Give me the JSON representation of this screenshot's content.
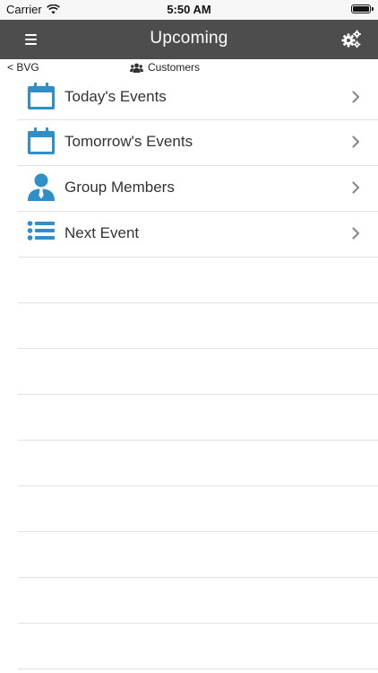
{
  "status_bar": {
    "carrier": "Carrier",
    "time": "5:50 AM"
  },
  "nav": {
    "title": "Upcoming"
  },
  "sub_header": {
    "back_label": "< BVG",
    "customers_label": "Customers"
  },
  "menu_items": [
    {
      "label": "Today's Events",
      "icon": "calendar-icon"
    },
    {
      "label": "Tomorrow's Events",
      "icon": "calendar-icon"
    },
    {
      "label": "Group Members",
      "icon": "person-icon"
    },
    {
      "label": "Next Event",
      "icon": "list-icon"
    }
  ],
  "colors": {
    "accent": "#2f8fc6",
    "navbar": "#4d4d4d",
    "divider": "#e2e2e2"
  }
}
